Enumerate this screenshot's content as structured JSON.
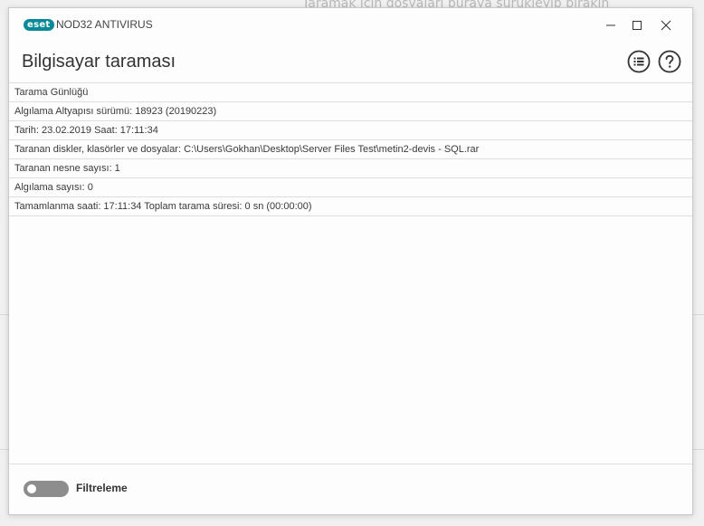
{
  "background": {
    "drop_hint": "Taramak için dosyaları buraya sürükleyip bırakın"
  },
  "window": {
    "brand": "eset",
    "product": "NOD32 ANTIVIRUS",
    "title": "Bilgisayar taraması",
    "brand_color": "#0a8a99"
  },
  "log": {
    "rows": [
      "Tarama Günlüğü",
      "Algılama Altyapısı sürümü: 18923 (20190223)",
      "Tarih: 23.02.2019  Saat: 17:11:34",
      "Taranan diskler, klasörler ve dosyalar: C:\\Users\\Gokhan\\Desktop\\Server Files Test\\metin2-devis - SQL.rar",
      "Taranan nesne sayısı: 1",
      "Algılama sayısı: 0",
      "Tamamlanma saati: 17:11:34  Toplam tarama süresi: 0 sn (00:00:00)"
    ]
  },
  "footer": {
    "filter_label": "Filtreleme",
    "filter_enabled": false
  },
  "icons": {
    "minimize": "minimize-icon",
    "maximize": "maximize-icon",
    "close": "close-icon",
    "list": "list-icon",
    "help": "help-icon"
  }
}
